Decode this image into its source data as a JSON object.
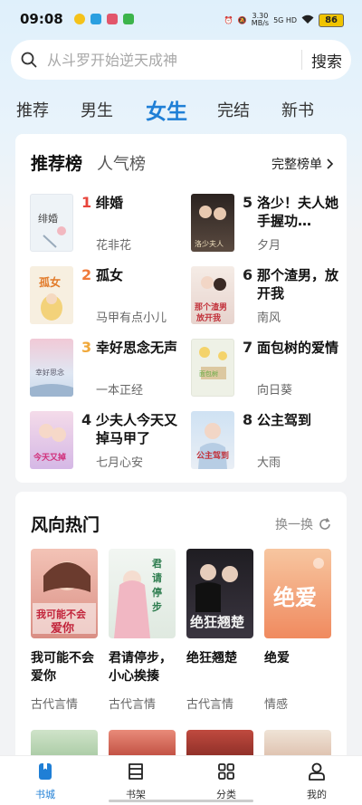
{
  "status": {
    "time": "09:08",
    "net_speed_top": "3.30",
    "net_speed_bottom": "MB/s",
    "signal": "5G HD",
    "battery": "86"
  },
  "search": {
    "placeholder": "从斗罗开始逆天成神",
    "button": "搜索"
  },
  "tabs": [
    {
      "label": "推荐"
    },
    {
      "label": "男生"
    },
    {
      "label": "女生",
      "active": true
    },
    {
      "label": "完结"
    },
    {
      "label": "新书"
    }
  ],
  "ranking": {
    "tab_active": "推荐榜",
    "tab_other": "人气榜",
    "full_list": "完整榜单",
    "books": [
      {
        "rank": "1",
        "title": "绯婚",
        "author": "花非花",
        "rank_color": "#e8453c",
        "cover_color": "#eef3f7"
      },
      {
        "rank": "2",
        "title": "孤女",
        "author": "马甲有点小儿",
        "rank_color": "#f07a3a",
        "cover_color": "#f7efe0"
      },
      {
        "rank": "3",
        "title": "幸好思念无声",
        "author": "一本正经",
        "rank_color": "#f0a83a",
        "cover_color": "#dfe7f3"
      },
      {
        "rank": "4",
        "title": "少夫人今天又掉马甲了",
        "author": "七月心安",
        "rank_color": "#222222",
        "cover_color": "#e8d6ef"
      },
      {
        "rank": "5",
        "title": "洛少！夫人她手握功…",
        "author": "夕月",
        "rank_color": "#222222",
        "cover_color": "#3b2f2b"
      },
      {
        "rank": "6",
        "title": "那个渣男，放开我",
        "author": "南风",
        "rank_color": "#222222",
        "cover_color": "#f2e4e0"
      },
      {
        "rank": "7",
        "title": "面包树的爱情",
        "author": "向日葵",
        "rank_color": "#222222",
        "cover_color": "#eef1e6"
      },
      {
        "rank": "8",
        "title": "公主驾到",
        "author": "大雨",
        "rank_color": "#222222",
        "cover_color": "#d7e6f3"
      }
    ]
  },
  "trending": {
    "title": "风向热门",
    "refresh": "换一换",
    "books": [
      {
        "title": "我可能不会爱你",
        "genre": "古代言情",
        "cover_text": "我可能不会爱你",
        "cover_color": "#d98e84"
      },
      {
        "title": "君请停步，小心挨揍",
        "genre": "古代言情",
        "cover_text": "君请停步",
        "cover_color": "#e6efe6"
      },
      {
        "title": "绝狂翘楚",
        "genre": "古代言情",
        "cover_text": "绝狂翘楚",
        "cover_color": "#2f2d33"
      },
      {
        "title": "绝爱",
        "genre": "情感",
        "cover_text": "绝爱",
        "cover_color": "#f3a07a"
      }
    ]
  },
  "nav": [
    {
      "label": "书城",
      "active": true
    },
    {
      "label": "书架"
    },
    {
      "label": "分类"
    },
    {
      "label": "我的"
    }
  ]
}
